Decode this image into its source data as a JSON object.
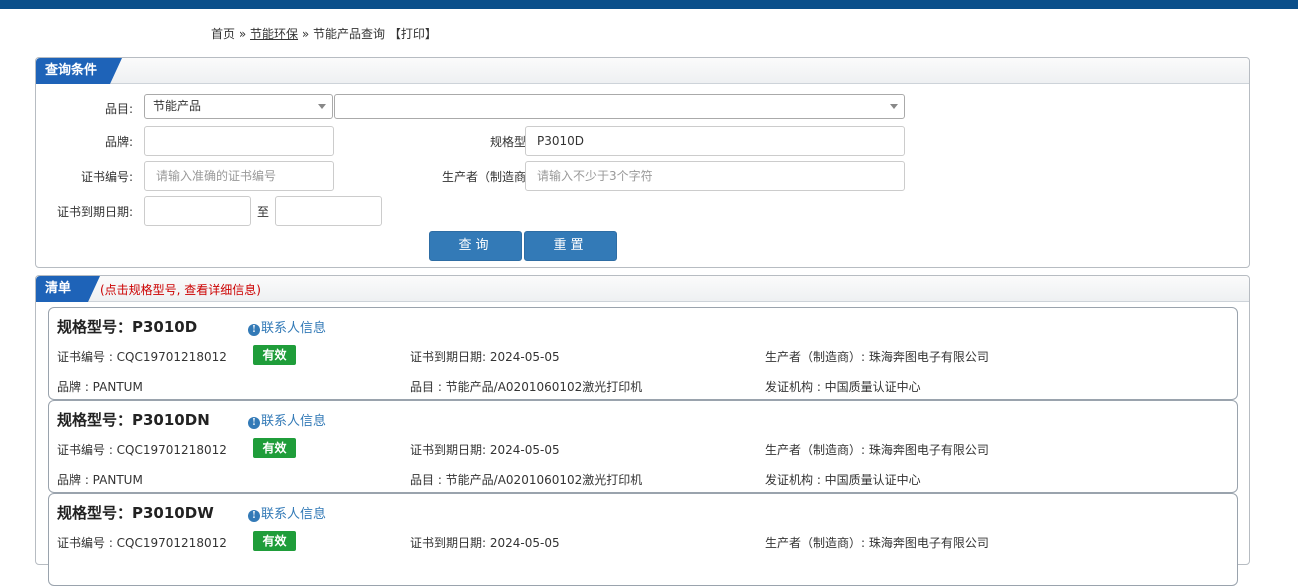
{
  "breadcrumb": {
    "home": "首页",
    "sep": "»",
    "section": "节能环保",
    "page": "节能产品查询",
    "print": "【打印】"
  },
  "query": {
    "title": "查询条件",
    "category_label": "品目:",
    "category_value": "节能产品",
    "subcategory_value": "",
    "brand_label": "品牌:",
    "brand_value": "",
    "model_label": "规格型号:",
    "model_value": "P3010D",
    "cert_label": "证书编号:",
    "cert_placeholder": "请输入准确的证书编号",
    "maker_label": "生产者（制造商）:",
    "maker_placeholder": "请输入不少于3个字符",
    "expiry_label": "证书到期日期:",
    "expiry_from": "",
    "expiry_to_sep": "至",
    "expiry_to": "",
    "search_button": "查询",
    "reset_button": "重置"
  },
  "list": {
    "title": "清单",
    "hint": "(点击规格型号, 查看详细信息)",
    "contact_label": "联系人信息",
    "items": [
      {
        "model": "规格型号：P3010D",
        "cert": "证书编号 : CQC19701218012",
        "status": "有效",
        "expiry": "证书到期日期: 2024-05-05",
        "maker": "生产者（制造商）: 珠海奔图电子有限公司",
        "brand": "品牌 : PANTUM",
        "category": "品目 : 节能产品/A0201060102激光打印机",
        "issuer": "发证机构 : 中国质量认证中心"
      },
      {
        "model": "规格型号：P3010DN",
        "cert": "证书编号 : CQC19701218012",
        "status": "有效",
        "expiry": "证书到期日期: 2024-05-05",
        "maker": "生产者（制造商）: 珠海奔图电子有限公司",
        "brand": "品牌 : PANTUM",
        "category": "品目 : 节能产品/A0201060102激光打印机",
        "issuer": "发证机构 : 中国质量认证中心"
      },
      {
        "model": "规格型号：P3010DW",
        "cert": "证书编号 : CQC19701218012",
        "status": "有效",
        "expiry": "证书到期日期: 2024-05-05",
        "maker": "生产者（制造商）: 珠海奔图电子有限公司",
        "brand": "",
        "category": "",
        "issuer": ""
      }
    ]
  },
  "colors": {
    "brand": "#0b4f8a",
    "tab": "#1e63b8",
    "button": "#337ab7",
    "valid": "#1f9d3a",
    "hint": "#cc0000"
  }
}
